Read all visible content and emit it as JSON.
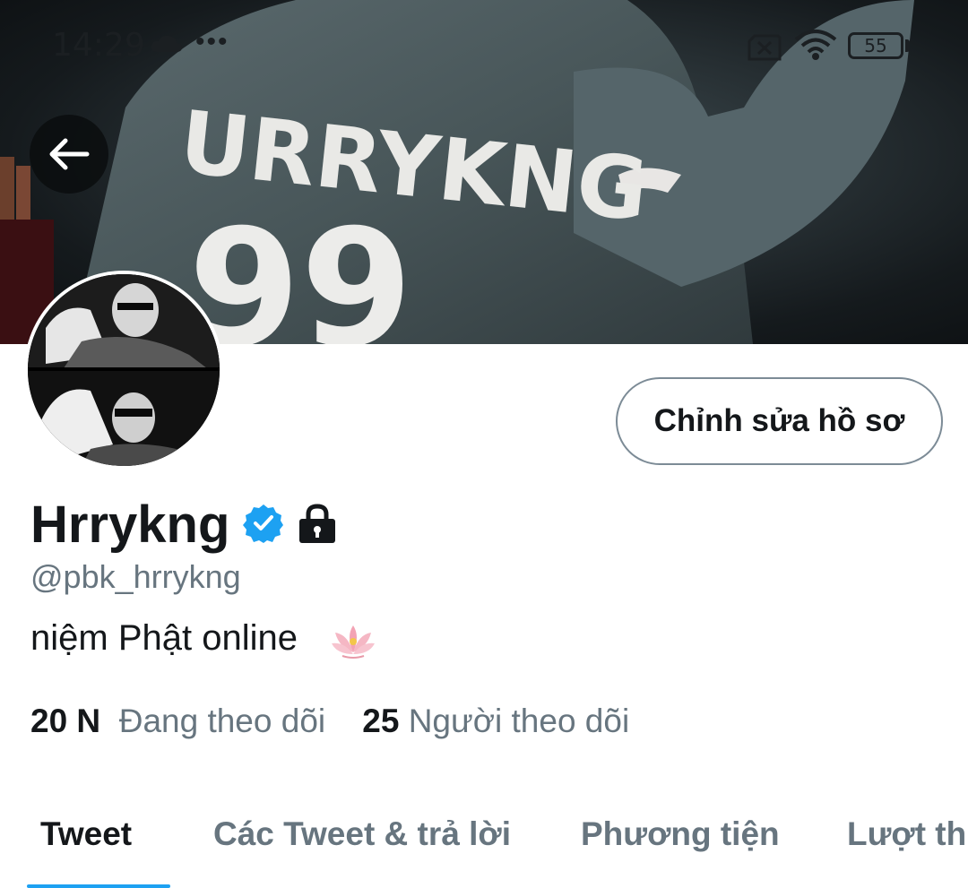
{
  "status_bar": {
    "time": "14:29",
    "dots": "•••",
    "battery": "55",
    "icons": [
      "cloud-icon",
      "sim-off-icon",
      "wifi-icon",
      "battery-icon"
    ]
  },
  "banner": {
    "jersey_text": "URRYKNG",
    "jersey_number": "99"
  },
  "profile": {
    "edit_button": "Chỉnh sửa hồ sơ",
    "display_name": "Hrrykng",
    "handle": "@pbk_hrrykng",
    "bio": "niệm Phật online",
    "verified_color": "#1da1f2",
    "following_count": "20 N",
    "following_label": "Đang theo dõi",
    "followers_count": "25",
    "followers_label": "Người theo dõi"
  },
  "tabs": [
    {
      "label": "Tweet",
      "active": true
    },
    {
      "label": "Các Tweet & trả lời",
      "active": false
    },
    {
      "label": "Phương tiện",
      "active": false
    },
    {
      "label": "Lượt thích",
      "active": false
    }
  ],
  "colors": {
    "accent": "#1da1f2",
    "text_primary": "#14171a",
    "text_secondary": "#67757f"
  }
}
